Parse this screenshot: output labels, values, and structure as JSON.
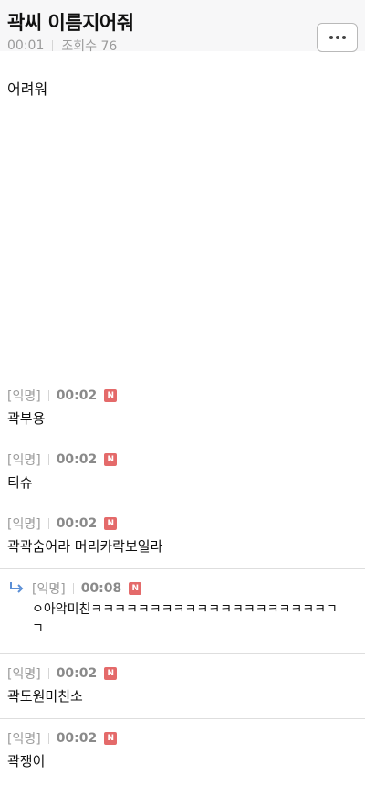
{
  "post": {
    "title": "곽씨 이름지어줘",
    "time": "00:01",
    "views": "조회수 76",
    "body": "어려워"
  },
  "icons": {
    "more": "more-icon",
    "reply": "reply-arrow-icon",
    "new_badge_color": "#e46a6a"
  },
  "comments": [
    {
      "author": "[익명]",
      "time": "00:02",
      "badge": "N",
      "text": "곽부용"
    },
    {
      "author": "[익명]",
      "time": "00:02",
      "badge": "N",
      "text": "티슈"
    },
    {
      "author": "[익명]",
      "time": "00:02",
      "badge": "N",
      "text": "곽곽숨어라 머리카락보일라"
    },
    {
      "author": "[익명]",
      "time": "00:08",
      "badge": "N",
      "text": "ㅇ아악미친ㅋㅋㅋㅋㅋㅋㅋㅋㅋㅋㅋㅋㅋㅋㅋㅋㅋㅋㅋㅋㄱㄱ",
      "is_reply": true
    },
    {
      "author": "[익명]",
      "time": "00:02",
      "badge": "N",
      "text": "곽도원미친소"
    },
    {
      "author": "[익명]",
      "time": "00:02",
      "badge": "N",
      "text": "곽쟁이"
    }
  ]
}
